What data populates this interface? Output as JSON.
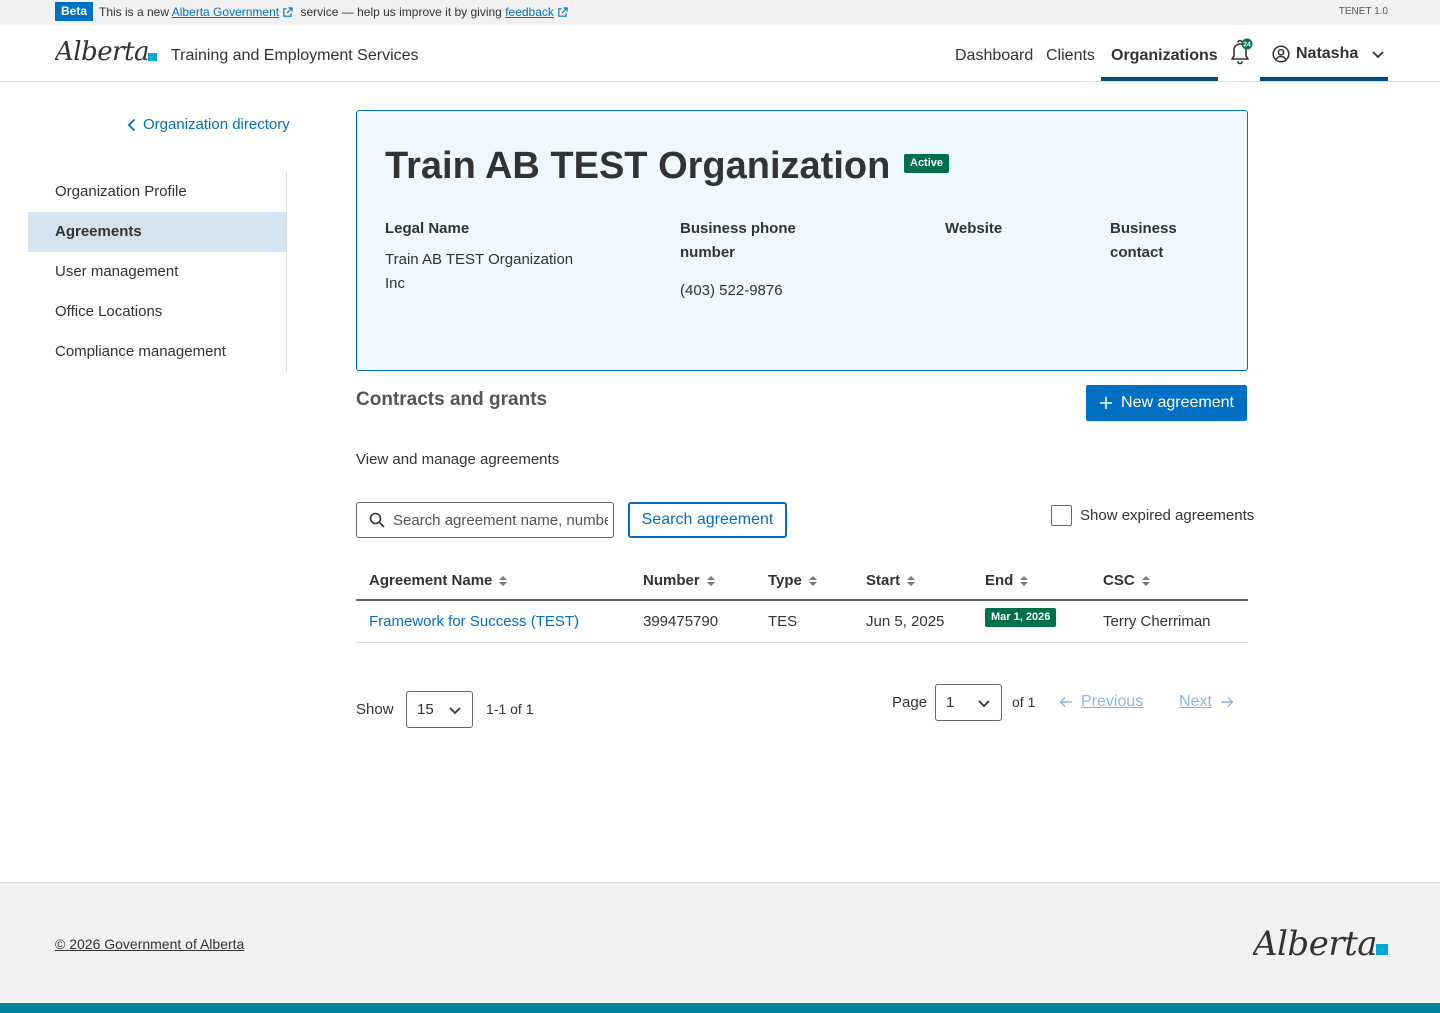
{
  "beta_bar": {
    "badge": "Beta",
    "text_before": "This is a new",
    "gov_link": "Alberta Government",
    "text_middle": "service — help us improve it by giving",
    "feedback_link": "feedback",
    "version": "TENET 1.0"
  },
  "header": {
    "logo_text": "Alberta",
    "service_name": "Training and Employment Services",
    "nav": [
      {
        "label": "Dashboard"
      },
      {
        "label": "Clients"
      },
      {
        "label": "Organizations",
        "active": true
      }
    ],
    "notification_count": "24",
    "user_name": "Natasha"
  },
  "sidebar": {
    "back_link": "Organization directory",
    "items": [
      {
        "label": "Organization Profile"
      },
      {
        "label": "Agreements",
        "active": true
      },
      {
        "label": "User management"
      },
      {
        "label": "Office Locations"
      },
      {
        "label": "Compliance management"
      }
    ]
  },
  "organization": {
    "name": "Train AB TEST Organization",
    "status": "Active",
    "legal_name_label": "Legal Name",
    "legal_name_line1": "Train AB TEST Organization",
    "legal_name_line2": "Inc",
    "phone_label_line1": "Business phone",
    "phone_label_line2": "number",
    "phone": "(403) 522-9876",
    "website_label": "Website",
    "contact_label_line1": "Business",
    "contact_label_line2": "contact"
  },
  "agreements": {
    "title": "Contracts and grants",
    "new_button": "New agreement",
    "description": "View and manage agreements",
    "search_placeholder": "Search agreement name, number",
    "search_button": "Search agreement",
    "show_expired": "Show expired agreements",
    "columns": [
      "Agreement Name",
      "Number",
      "Type",
      "Start",
      "End",
      "CSC"
    ],
    "rows": [
      {
        "name": "Framework for Success (TEST)",
        "number": "399475790",
        "type": "TES",
        "start": "Jun 5, 2025",
        "end": "Mar 1, 2026",
        "csc": "Terry Cherriman"
      }
    ]
  },
  "pagination": {
    "show_label": "Show",
    "per_page": "15",
    "count_text": "1-1 of 1",
    "page_label": "Page",
    "page": "1",
    "of_text": "of 1",
    "previous": "Previous",
    "next": "Next"
  },
  "footer": {
    "copyright": "© 2026 Government of Alberta",
    "logo_text": "Alberta"
  },
  "colors": {
    "primary": "#0070c4",
    "success": "#006f4c",
    "nav_underline": "#004f84",
    "card_bg": "#eff8ff",
    "footer_bar": "#0081a2"
  }
}
